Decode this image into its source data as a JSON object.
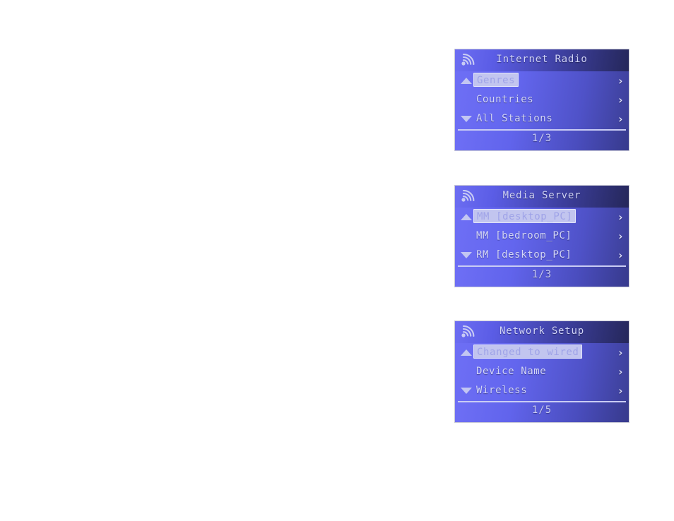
{
  "page": {
    "background": "#ffffff",
    "accent": "#6a6bf0",
    "text_color": "#d3d6f8",
    "highlight_bg": "#c2c5ef"
  },
  "screens": [
    {
      "id": "internet-radio",
      "icon": "wifi-signal-icon",
      "title": "Internet Radio",
      "scroll_up": "▲",
      "scroll_down": "▼",
      "chevron": "›",
      "items": [
        {
          "label": "Genres",
          "selected": true,
          "has_chevron": true,
          "arrow": "up"
        },
        {
          "label": "Countries",
          "selected": false,
          "has_chevron": true,
          "arrow": "none"
        },
        {
          "label": "All Stations",
          "selected": false,
          "has_chevron": true,
          "arrow": "down"
        }
      ],
      "page_indicator": "1/3"
    },
    {
      "id": "media-server",
      "icon": "wifi-signal-icon",
      "title": "Media Server",
      "scroll_up": "▲",
      "scroll_down": "▼",
      "chevron": "›",
      "items": [
        {
          "label": "MM [desktop_PC]",
          "selected": true,
          "has_chevron": true,
          "arrow": "up"
        },
        {
          "label": "MM [bedroom_PC]",
          "selected": false,
          "has_chevron": true,
          "arrow": "none"
        },
        {
          "label": "RM [desktop_PC]",
          "selected": false,
          "has_chevron": true,
          "arrow": "down"
        }
      ],
      "page_indicator": "1/3"
    },
    {
      "id": "network-setup",
      "icon": "wifi-signal-icon",
      "title": "Network Setup",
      "scroll_up": "▲",
      "scroll_down": "▼",
      "chevron": "›",
      "items": [
        {
          "label": "Changed to wired",
          "selected": true,
          "has_chevron": true,
          "arrow": "up"
        },
        {
          "label": "Device Name",
          "selected": false,
          "has_chevron": true,
          "arrow": "none"
        },
        {
          "label": "Wireless",
          "selected": false,
          "has_chevron": true,
          "arrow": "down"
        }
      ],
      "page_indicator": "1/5"
    }
  ]
}
